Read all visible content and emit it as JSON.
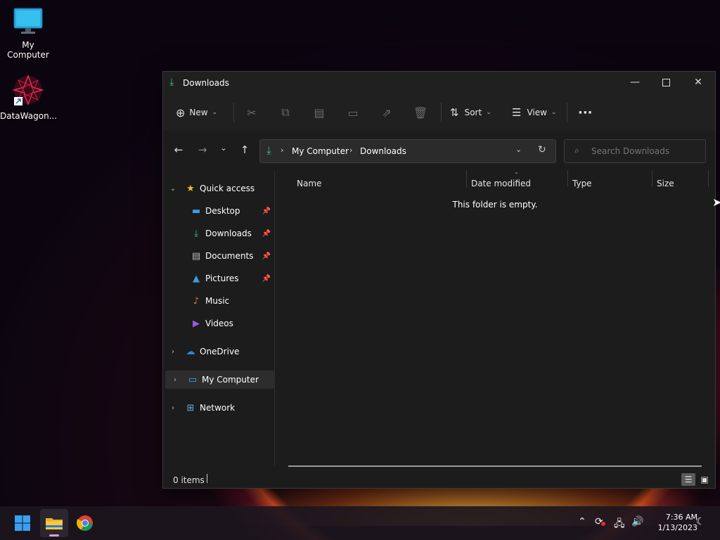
{
  "desktop": {
    "icons": [
      {
        "label": "My Computer",
        "icon": "monitor-icon"
      },
      {
        "label": "DataWagon...",
        "icon": "datawagon-shortcut-icon"
      }
    ]
  },
  "window": {
    "title": "Downloads",
    "toolbar": {
      "new_label": "New",
      "sort_label": "Sort",
      "view_label": "View",
      "more_label": "···"
    },
    "address": {
      "crumbs": [
        "My Computer",
        "Downloads"
      ]
    },
    "search": {
      "placeholder": "Search Downloads"
    },
    "sidebar": {
      "quick_access": "Quick access",
      "items": [
        {
          "label": "Desktop",
          "pinned": true
        },
        {
          "label": "Downloads",
          "pinned": true
        },
        {
          "label": "Documents",
          "pinned": true
        },
        {
          "label": "Pictures",
          "pinned": true
        },
        {
          "label": "Music",
          "pinned": false
        },
        {
          "label": "Videos",
          "pinned": false
        }
      ],
      "onedrive": "OneDrive",
      "my_computer": "My Computer",
      "network": "Network"
    },
    "columns": [
      "Name",
      "Date modified",
      "Type",
      "Size"
    ],
    "empty_text": "This folder is empty.",
    "status": {
      "items": "0 items"
    }
  },
  "taskbar": {
    "clock": {
      "time": "7:36 AM",
      "date": "1/13/2023"
    }
  },
  "colors": {
    "accent": "#0078d4",
    "window_bg": "#1c1c1c",
    "selected": "#2d2d2d"
  }
}
